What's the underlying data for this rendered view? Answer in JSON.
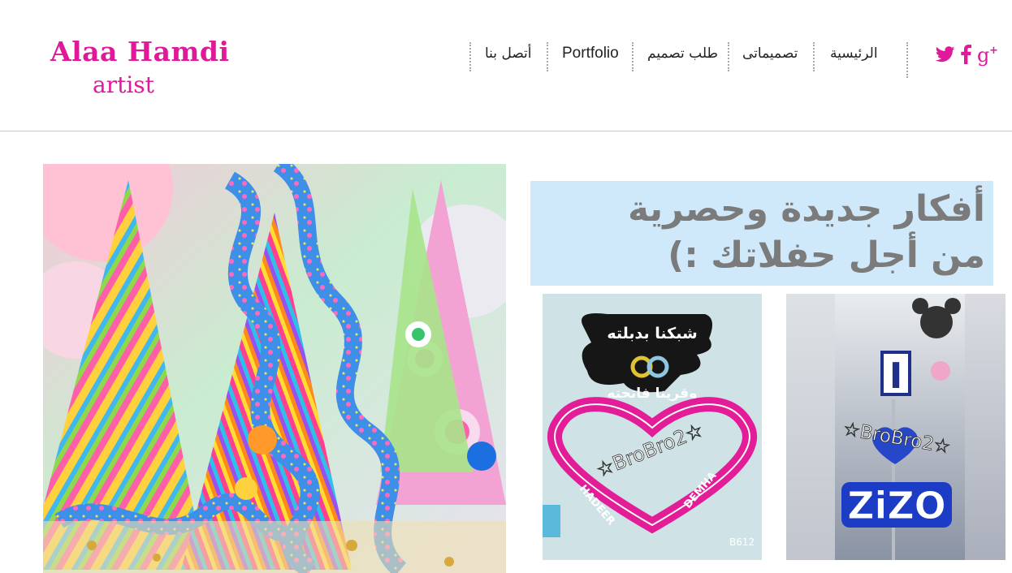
{
  "header": {
    "logo_name": "Alaa Hamdi",
    "logo_sub": "artist",
    "nav": {
      "home": "الرئيسية",
      "designs": "تصميماتى",
      "order": "طلب تصميم",
      "portfolio": "Portfolio",
      "contact": "أتصل بنا"
    },
    "social": [
      "twitter-icon",
      "facebook-icon",
      "google-plus-icon"
    ]
  },
  "main": {
    "headline": [
      "أفكار جديدة وحصرية",
      "من أجل حفلاتك :)"
    ],
    "photo_engagement": {
      "top_text": "شبكنا بدبلته",
      "mid_text": "وقرينا فاتحته",
      "watermark": "☆BroBro2☆",
      "names_left": "HADEER",
      "names_right": "DEMHA",
      "corner": "B612"
    },
    "photo_zizo": {
      "letter": "I",
      "watermark": "☆BroBro2☆",
      "name": "ZiZO"
    }
  },
  "colors": {
    "accent": "#e0199b",
    "headline_bg": "#cfe9fb",
    "headline_text": "#7b7b7b"
  }
}
